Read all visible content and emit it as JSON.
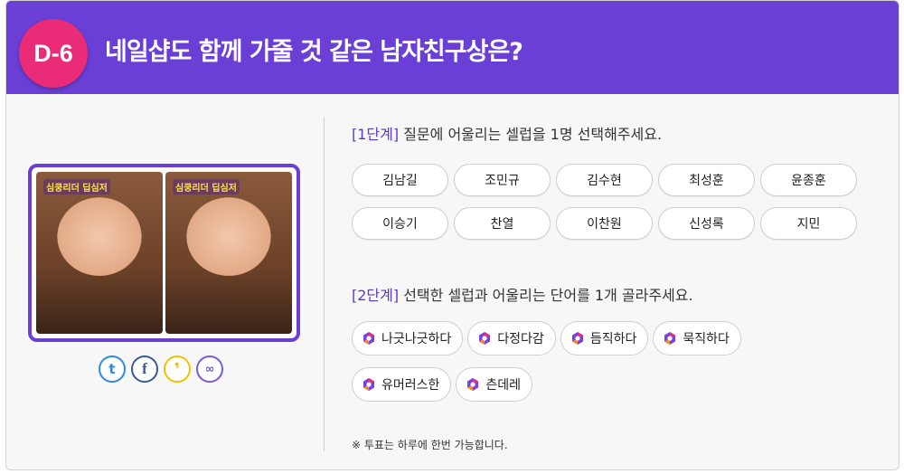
{
  "header": {
    "badge": "D-6",
    "title": "네일샵도 함께 가줄 것 같은 남자친구상은?"
  },
  "photo": {
    "caption_left": "심쿵리더 딥심저",
    "caption_right": "심쿵리더 딥심저"
  },
  "share": {
    "twitter_glyph": "t",
    "facebook_glyph": "f",
    "kakaostory_glyph": "❜",
    "link_glyph": "∞"
  },
  "step1": {
    "tag": "[1단계]",
    "text": " 질문에 어울리는 셀럽을 1명 선택해주세요."
  },
  "celebs": [
    "김남길",
    "조민규",
    "김수현",
    "최성훈",
    "윤종훈",
    "이승기",
    "찬열",
    "이찬원",
    "신성록",
    "지민"
  ],
  "step2": {
    "tag": "[2단계]",
    "text": " 선택한 셀럽과 어울리는 단어를 1개 골라주세요."
  },
  "words": [
    "나긋나긋하다",
    "다정다감",
    "듬직하다",
    "묵직하다",
    "유머러스한",
    "츤데레"
  ],
  "note": "※ 투표는 하루에 한번 가능합니다.",
  "colors": {
    "header": "#6a3fd6",
    "badge": "#ea2b77",
    "step_tag": "#5a3ad0"
  }
}
